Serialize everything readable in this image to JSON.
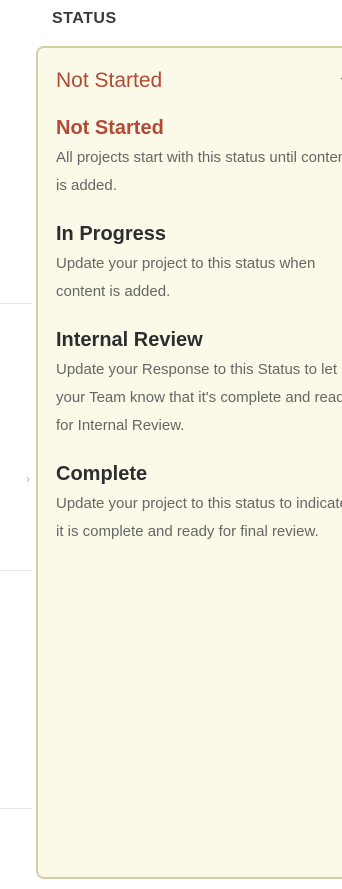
{
  "header": {
    "label": "STATUS"
  },
  "dropdown": {
    "selected": "Not Started",
    "options": [
      {
        "title": "Not Started",
        "desc": "All projects start with this status until content is added."
      },
      {
        "title": "In Progress",
        "desc": "Update your project to this status when content is added."
      },
      {
        "title": "Internal Review",
        "desc": "Update your Response to this Status to let your Team know that it's complete and ready for Internal Review."
      },
      {
        "title": "Complete",
        "desc": "Update your project to this status to indicate it is complete and ready for final review."
      }
    ]
  },
  "colors": {
    "accent": "#b34a35",
    "panel_background": "#fbfae9",
    "panel_border": "#d4cfa3"
  },
  "icons": {
    "dropdown_chevron": "chevron-down-icon"
  }
}
